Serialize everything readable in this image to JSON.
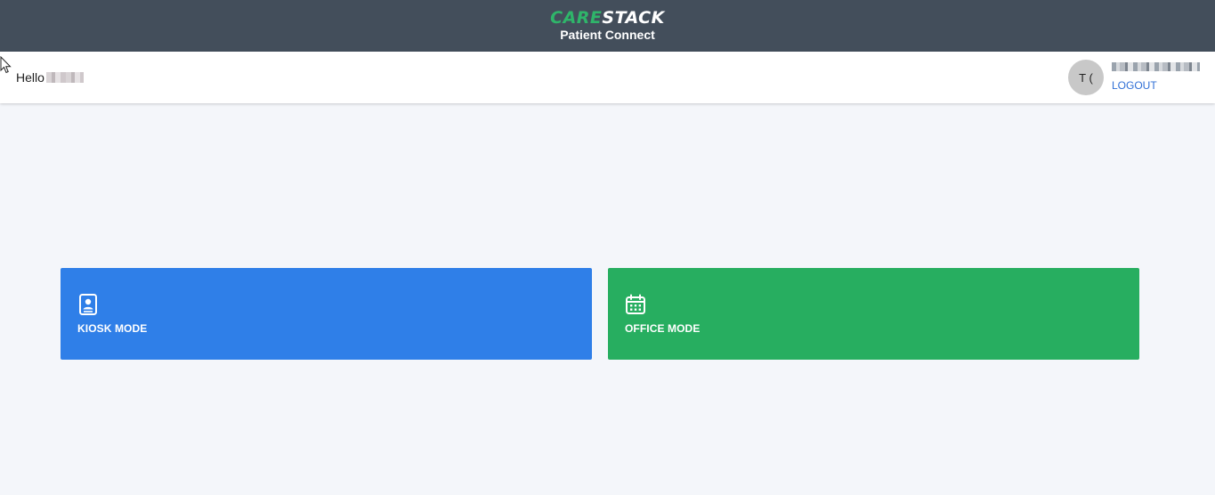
{
  "header": {
    "logo_part1": "CARE",
    "logo_part2": "STACK",
    "subtitle": "Patient Connect"
  },
  "userbar": {
    "greeting": "Hello",
    "avatar_initials": "T (",
    "logout_label": "LOGOUT"
  },
  "modes": [
    {
      "label": "KIOSK MODE",
      "icon": "kiosk-id-card-icon",
      "color": "#2f7fe8"
    },
    {
      "label": "OFFICE MODE",
      "icon": "calendar-icon",
      "color": "#27ae60"
    }
  ],
  "colors": {
    "header_bg": "#434e5b",
    "brand_green": "#2fb56a",
    "link_blue": "#2f6fd6",
    "page_bg": "#f4f6fa"
  }
}
